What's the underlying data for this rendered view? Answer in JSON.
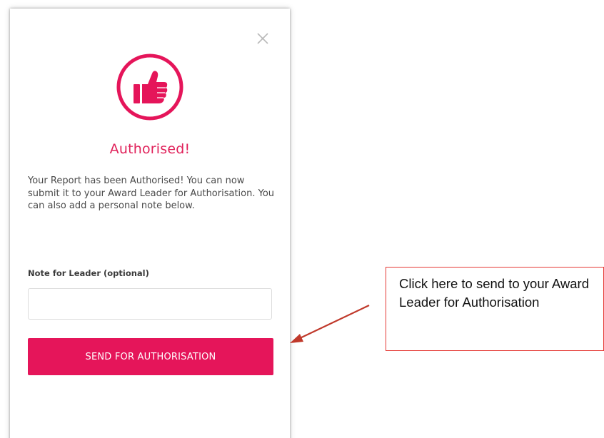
{
  "dialog": {
    "title": "Authorised!",
    "message": "Your Report has been Authorised! You can now submit it to your Award Leader for Authorisation. You can also add a personal note below.",
    "note_label": "Note for Leader (optional)",
    "note_value": "",
    "send_button_label": "SEND FOR AUTHORISATION",
    "icon": "thumbs-up-icon",
    "close_icon": "close-icon"
  },
  "annotation": {
    "callout_text": "Click here to send to your Award Leader for Authorisation"
  },
  "colors": {
    "accent": "#e5155a",
    "title": "#e0215a",
    "callout_border": "#e53935",
    "arrow": "#c0392b"
  }
}
